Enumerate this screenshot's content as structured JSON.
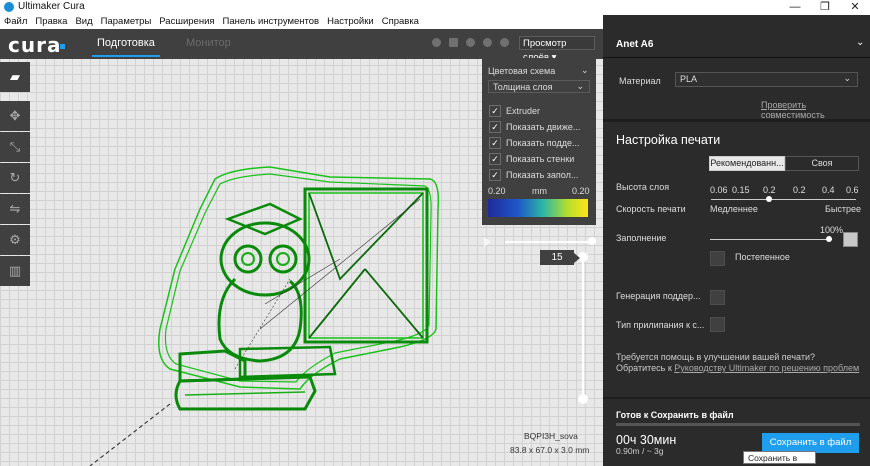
{
  "window": {
    "title": "Ultimaker Cura",
    "minimize": "—",
    "restore": "❐",
    "close": "✕"
  },
  "menu": [
    "Файл",
    "Правка",
    "Вид",
    "Параметры",
    "Расширения",
    "Панель инструментов",
    "Настройки",
    "Справка"
  ],
  "topbar": {
    "logo": "cura",
    "tab_prepare": "Подготовка",
    "tab_monitor": "Монитор",
    "view_mode": "Просмотр слоёв ▾"
  },
  "layer_panel": {
    "scheme_label": "Цветовая схема",
    "scheme_value": "Толщина слоя",
    "checks": [
      "Extruder",
      "Показать движе...",
      "Показать подде...",
      "Показать стенки",
      "Показать запол..."
    ],
    "min_value": "0.20",
    "unit": "mm",
    "max_value": "0.20",
    "gradient_colors": [
      "#1f2b99",
      "#1f58c9",
      "#2bb6a6",
      "#b7df2c",
      "#ffe31a"
    ]
  },
  "layer_slider": {
    "current_layer": "15"
  },
  "model": {
    "name": "BQPI3H_sova",
    "dimensions": "83.8 x 67.0 x 3.0 mm"
  },
  "sidebar": {
    "printer": "Anet A6",
    "material_label": "Материал",
    "material_value": "PLA",
    "compat_link": "Проверить совместимость",
    "print_setup_title": "Настройка печати",
    "tab_recommended": "Рекомендованн...",
    "tab_custom": "Своя",
    "layer_height_label": "Высота слоя",
    "layer_height_ticks": [
      "0.06",
      "0.15",
      "0.2",
      "0.2",
      "0.4",
      "0.6"
    ],
    "speed_label": "Скорость печати",
    "speed_slow": "Медленнее",
    "speed_fast": "Быстрее",
    "infill_label": "Заполнение",
    "infill_percent": "100%",
    "gradual_label": "Постепенное",
    "support_label": "Генерация поддер...",
    "adhesion_label": "Тип прилипания к с...",
    "help_line1": "Требуется помощь в улучшении вашей печати?",
    "help_line2_prefix": "Обратитесь к ",
    "help_link": "Руководству Ultimaker по решению проблем",
    "ready_label": "Готов к Сохранить в файл",
    "print_time": "00ч 30мин",
    "material_use": "0.90m / ~ 3g",
    "save_button": "Сохранить в файл",
    "tooltip": "Сохранить в файл"
  }
}
